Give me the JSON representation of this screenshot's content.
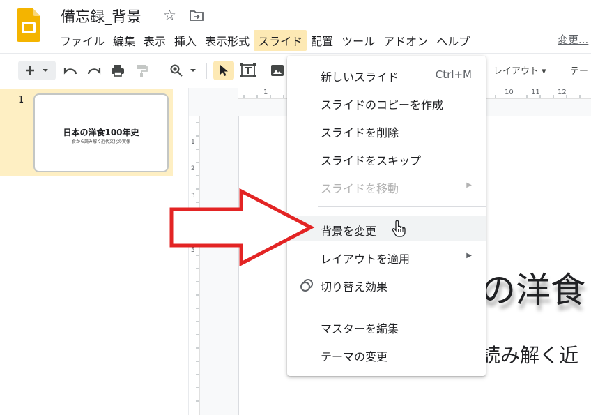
{
  "document": {
    "title": "備忘録_背景"
  },
  "menubar": {
    "items": [
      "ファイル",
      "編集",
      "表示",
      "挿入",
      "表示形式",
      "スライド",
      "配置",
      "ツール",
      "アドオン",
      "ヘルプ"
    ],
    "active_index": 5,
    "changes_link": "変更..."
  },
  "toolbar": {
    "layout_label": "レイアウト",
    "theme_label": "テー"
  },
  "filmstrip": {
    "slides": [
      {
        "number": "1",
        "title": "日本の洋食100年史",
        "subtitle": "食から読み解く近代文化の実像"
      }
    ]
  },
  "canvas": {
    "slide_title_partial": "の洋食",
    "slide_subtitle_partial": "読み解く近",
    "ruler_top_numbers": [
      "1",
      "10",
      "11",
      "12"
    ],
    "ruler_left_numbers": [
      "1",
      "2",
      "3",
      "4",
      "5"
    ]
  },
  "dropdown": {
    "items": [
      {
        "label": "新しいスライド",
        "shortcut": "Ctrl+M"
      },
      {
        "label": "スライドのコピーを作成"
      },
      {
        "label": "スライドを削除"
      },
      {
        "label": "スライドをスキップ"
      },
      {
        "label": "スライドを移動",
        "disabled": true,
        "submenu": true
      },
      {
        "label": "背景を変更",
        "hovered": true
      },
      {
        "label": "レイアウトを適用",
        "submenu": true
      },
      {
        "label": "切り替え効果",
        "icon": "transition-icon"
      },
      {
        "label": "マスターを編集"
      },
      {
        "label": "テーマの変更"
      }
    ]
  },
  "colors": {
    "active_menu_bg": "#fde9b4",
    "filmstrip_selected_bg": "#feefc3",
    "slides_brand_yellow": "#f4b400",
    "annotation_arrow_red": "#e32424"
  }
}
